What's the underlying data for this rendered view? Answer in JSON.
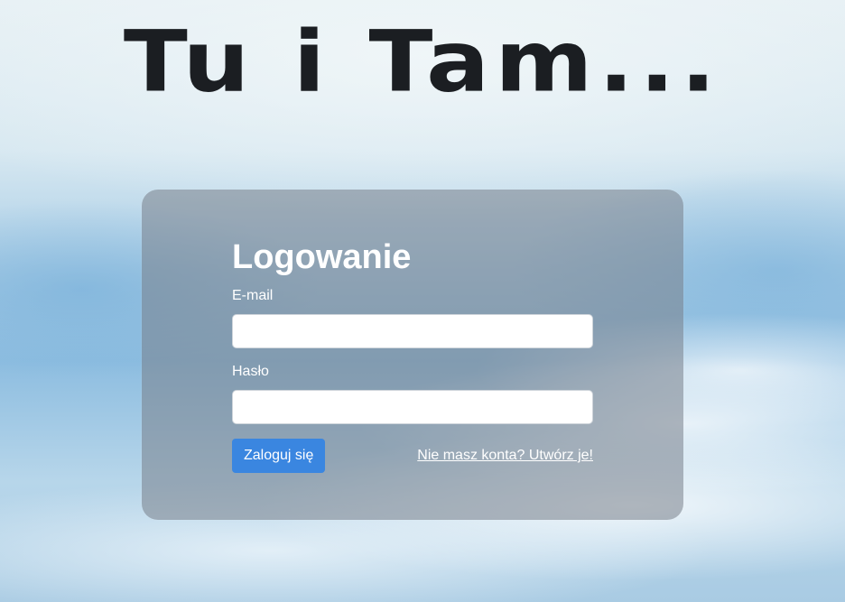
{
  "site": {
    "title": "Tu i Tam..."
  },
  "login": {
    "heading": "Logowanie",
    "email_label": "E-mail",
    "email_value": "",
    "password_label": "Hasło",
    "password_value": "",
    "submit_label": "Zaloguj się",
    "register_link": "Nie masz konta? Utwórz je!"
  },
  "colors": {
    "button": "#3a86e0",
    "card": "rgba(120,128,138,0.55)",
    "title": "#1b1e22"
  }
}
